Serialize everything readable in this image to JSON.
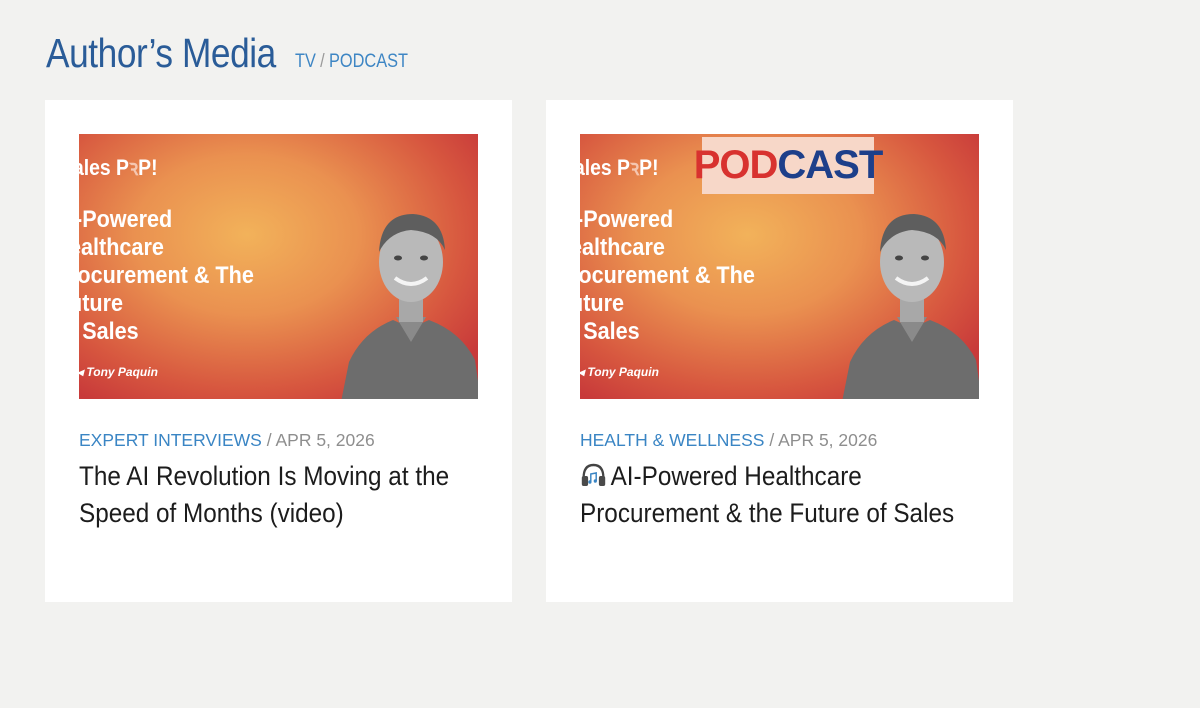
{
  "section": {
    "title": "Author’s Media",
    "subnav": {
      "tv": "TV",
      "separator": "/",
      "podcast": "PODCAST"
    }
  },
  "cards": [
    {
      "thumbnail": {
        "brand": "Sales P🎤P!",
        "brand_text": "ales P",
        "brand_tail": "P!",
        "headline_lines": [
          "I-Powered",
          "ealthcare",
          "rocurement & The",
          "uture",
          "f Sales"
        ],
        "byline": "Tony Paquin",
        "badge": null
      },
      "category": "EXPERT INTERVIEWS",
      "separator": "/",
      "date": "APR 5, 2026",
      "title": "The AI Revolution Is Moving at the Speed of Months (video)",
      "icon": null
    },
    {
      "thumbnail": {
        "brand_text": "ales P",
        "brand_tail": "P!",
        "headline_lines": [
          "I-Powered",
          "ealthcare",
          "rocurement & The",
          "uture",
          "f Sales"
        ],
        "byline": "Tony Paquin",
        "badge_part1": "POD",
        "badge_part2": "CAST"
      },
      "category": "HEALTH & WELLNESS",
      "separator": "/",
      "date": "APR 5, 2026",
      "title": "AI-Powered Healthcare Procurement & the Future of Sales",
      "icon": "headphones-icon"
    }
  ],
  "colors": {
    "page_bg": "#f2f2f0",
    "title_blue": "#2a5c98",
    "link_blue": "#3a85c4",
    "meta_gray": "#8e8e8e",
    "badge_red": "#d8322f",
    "badge_navy": "#1d3f8a"
  }
}
